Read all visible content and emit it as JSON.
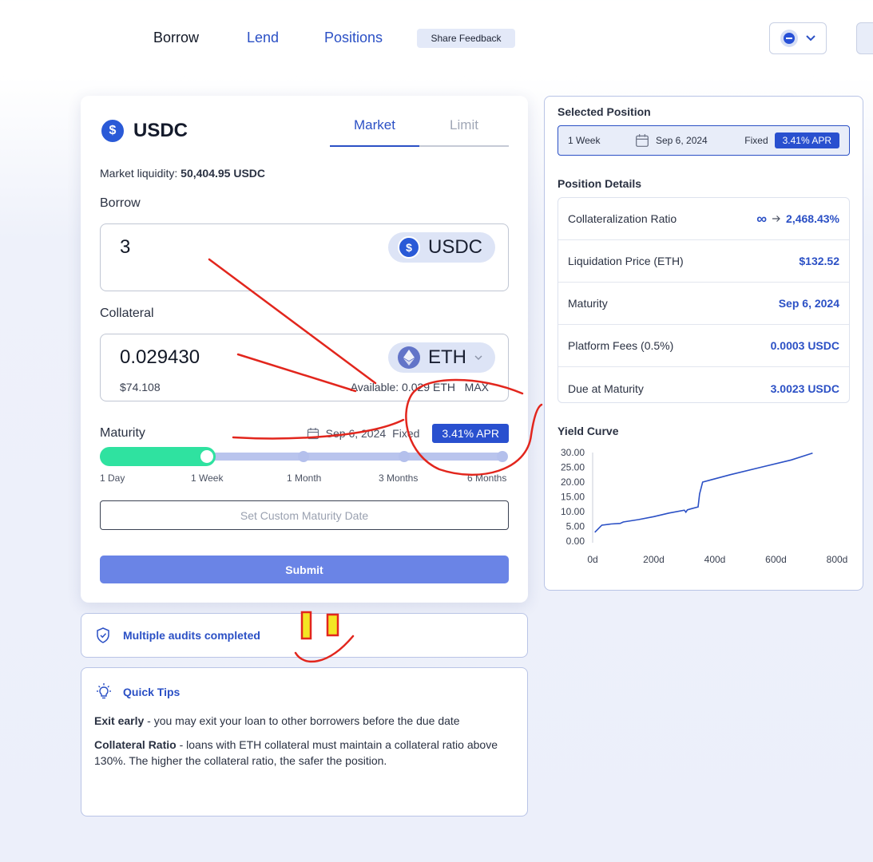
{
  "nav": {
    "items": [
      {
        "label": "Borrow",
        "active": true
      },
      {
        "label": "Lend",
        "active": false
      },
      {
        "label": "Positions",
        "active": false
      }
    ],
    "feedback_label": "Share Feedback"
  },
  "borrow_card": {
    "token": "USDC",
    "tabs": [
      "Market",
      "Limit"
    ],
    "liquidity_label": "Market liquidity:",
    "liquidity_value": "50,404.95 USDC",
    "borrow_label": "Borrow",
    "borrow_amount": "3",
    "borrow_token": "USDC",
    "collateral_label": "Collateral",
    "collateral_amount": "0.029430",
    "collateral_token": "ETH",
    "collateral_usd": "$74.108",
    "available": "Available: 0.029 ETH",
    "max_label": "MAX",
    "maturity_label": "Maturity",
    "maturity_date": "Sep 6, 2024",
    "rate_type": "Fixed",
    "apr": "3.41% APR",
    "slider_stops": [
      "1 Day",
      "1 Week",
      "1 Month",
      "3 Months",
      "6 Months"
    ],
    "selected_stop": "1 Week",
    "custom_date_label": "Set Custom Maturity Date",
    "submit_label": "Submit"
  },
  "audits": {
    "label": "Multiple audits completed"
  },
  "tips": {
    "title": "Quick Tips",
    "items": [
      {
        "title": "Exit early",
        "text": "- you may exit your loan to other borrowers before the due date"
      },
      {
        "title": "Collateral Ratio",
        "text": "- loans with ETH collateral must maintain a collateral ratio above 130%. The higher the collateral ratio, the safer the position."
      }
    ]
  },
  "selected_position": {
    "title": "Selected Position",
    "term": "1 Week",
    "date": "Sep 6, 2024",
    "rate_type": "Fixed",
    "apr": "3.41% APR"
  },
  "position_details": {
    "title": "Position Details",
    "rows": [
      {
        "label": "Collateralization Ratio",
        "from": "∞",
        "value": "2,468.43%"
      },
      {
        "label": "Liquidation Price (ETH)",
        "value": "$132.52"
      },
      {
        "label": "Maturity",
        "value": "Sep 6, 2024"
      },
      {
        "label": "Platform Fees (0.5%)",
        "value": "0.0003 USDC"
      },
      {
        "label": "Due at Maturity",
        "value": "3.0023 USDC"
      }
    ]
  },
  "yield_curve": {
    "title": "Yield Curve",
    "y_ticks": [
      "30.00",
      "25.00",
      "20.00",
      "15.00",
      "10.00",
      "5.00",
      "0.00"
    ],
    "x_ticks": [
      "0d",
      "200d",
      "400d",
      "600d",
      "800d"
    ]
  },
  "chart_data": {
    "type": "line",
    "xlim": [
      0,
      800
    ],
    "ylim": [
      0,
      30
    ],
    "x": [
      7,
      30,
      60,
      90,
      100,
      150,
      200,
      250,
      300,
      305,
      310,
      320,
      345,
      350,
      360,
      450,
      550,
      650,
      720
    ],
    "y": [
      3.0,
      5.4,
      5.8,
      6.0,
      6.5,
      7.3,
      8.3,
      9.5,
      10.5,
      9.8,
      10.6,
      10.9,
      11.6,
      16.0,
      20.0,
      22.5,
      25.0,
      27.5,
      29.8
    ],
    "series": [
      {
        "values_ref": "y"
      }
    ],
    "grid": false,
    "line_color": "#2b50c5"
  },
  "colors": {
    "accent": "#2b50c5",
    "slider_fill": "#2fe2a0",
    "submit": "#6a84e6",
    "apr_badge": "#2950cf"
  }
}
